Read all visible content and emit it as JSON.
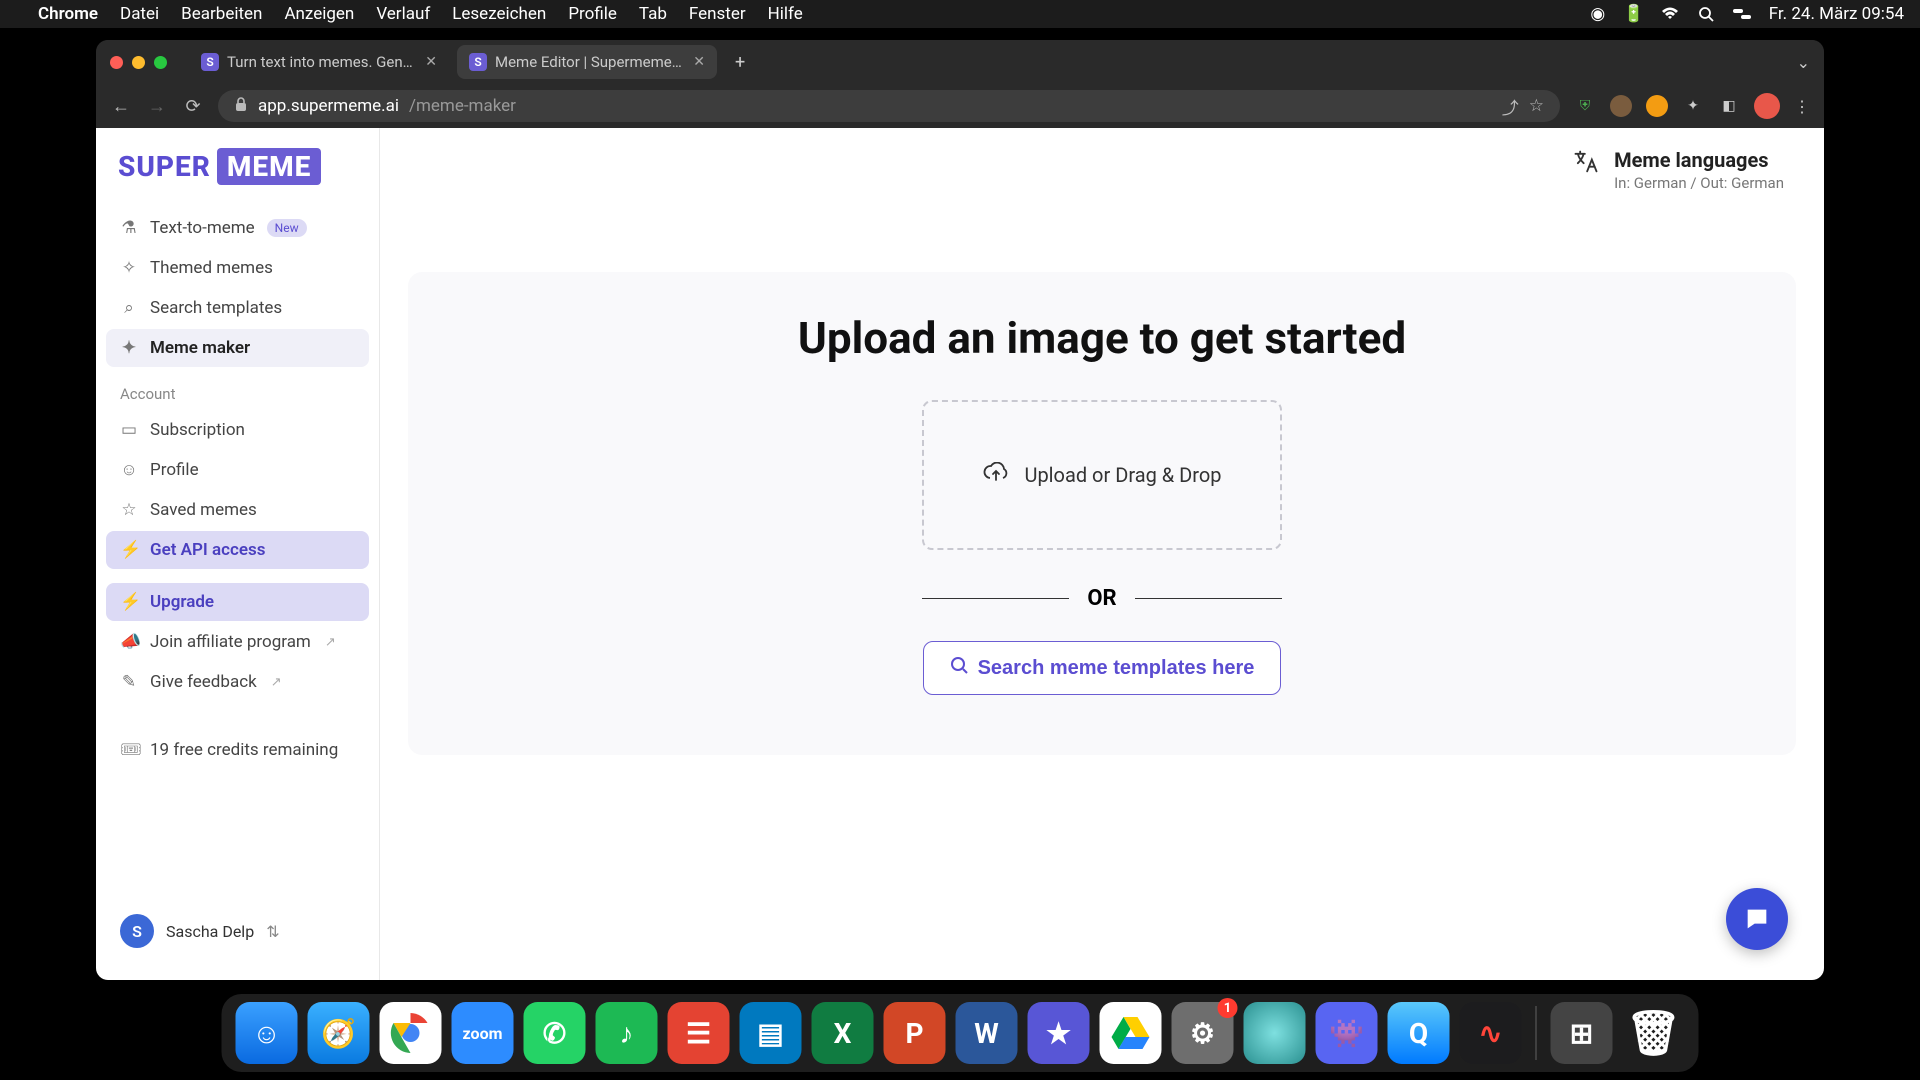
{
  "menubar": {
    "app": "Chrome",
    "items": [
      "Datei",
      "Bearbeiten",
      "Anzeigen",
      "Verlauf",
      "Lesezeichen",
      "Profile",
      "Tab",
      "Fenster",
      "Hilfe"
    ],
    "clock": "Fr. 24. März  09:54"
  },
  "tabs": {
    "tab1": "Turn text into memes. Generat",
    "tab2": "Meme Editor | Supermeme.ai"
  },
  "url": {
    "domain": "app.supermeme.ai",
    "path": "/meme-maker"
  },
  "logo": {
    "super": "SUPER",
    "meme": "MEME"
  },
  "sidebar": {
    "text_to_meme": "Text-to-meme",
    "new_badge": "New",
    "themed": "Themed memes",
    "search_templates": "Search templates",
    "meme_maker": "Meme maker",
    "account_label": "Account",
    "subscription": "Subscription",
    "profile": "Profile",
    "saved": "Saved memes",
    "api": "Get API access",
    "upgrade": "Upgrade",
    "affiliate": "Join affiliate program",
    "feedback": "Give feedback",
    "credits": "19 free credits remaining"
  },
  "lang": {
    "title": "Meme languages",
    "sub": "In: German / Out: German"
  },
  "main": {
    "heading": "Upload an image to get started",
    "drop": "Upload or Drag & Drop",
    "or": "OR",
    "search_btn": "Search meme templates here"
  },
  "user": {
    "initial": "S",
    "name": "Sascha Delp"
  },
  "dock": {
    "badge_settings": "1"
  }
}
